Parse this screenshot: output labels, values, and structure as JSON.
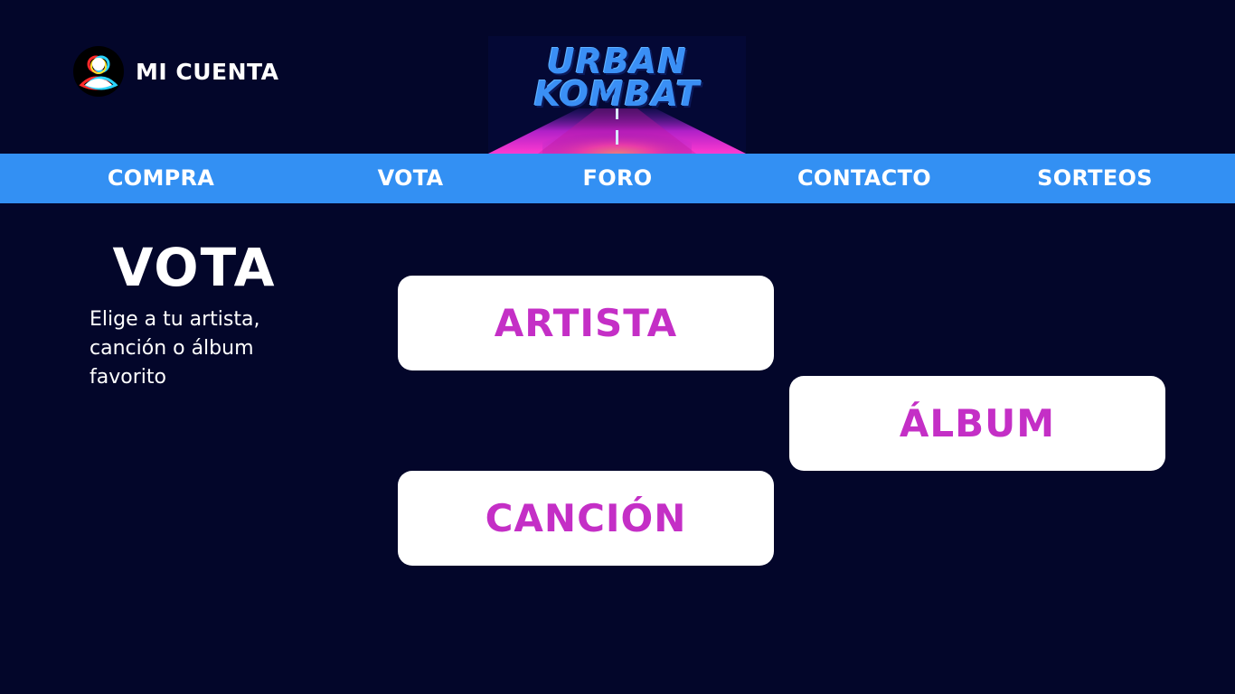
{
  "account": {
    "label": "MI CUENTA",
    "icon": "user-glitch-icon"
  },
  "logo": {
    "line1": "URBAN",
    "line2": "KOMBAT"
  },
  "nav": {
    "items": [
      {
        "label": "COMPRA"
      },
      {
        "label": "VOTA"
      },
      {
        "label": "FORO"
      },
      {
        "label": "CONTACTO"
      },
      {
        "label": "SORTEOS"
      }
    ]
  },
  "main": {
    "title": "VOTA",
    "subtitle": "Elige a tu artista,\ncanción o álbum\nfavorito",
    "choices": {
      "artist": "ARTISTA",
      "album": "ÁLBUM",
      "song": "CANCIÓN"
    }
  },
  "colors": {
    "background": "#03062a",
    "nav": "#3390f3",
    "accent": "#c42fc6",
    "logo": "#3a8ff5"
  }
}
